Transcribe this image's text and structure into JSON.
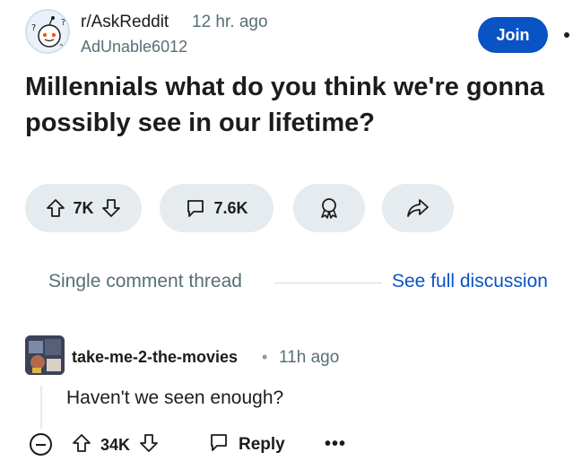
{
  "post": {
    "subreddit": "r/AskReddit",
    "time": "12 hr. ago",
    "author": "AdUnable6012",
    "join_label": "Join",
    "title": "Millennials what do you think we're gonna possibly see in our lifetime?",
    "votes": "7K",
    "comments": "7.6K"
  },
  "thread": {
    "label": "Single comment thread",
    "full_link": "See full discussion"
  },
  "comment": {
    "author": "take-me-2-the-movies",
    "separator": "•",
    "time": "11h ago",
    "body": "Haven't we seen enough?",
    "votes": "34K",
    "reply_label": "Reply",
    "more_label": "•••"
  },
  "colors": {
    "accent": "#0a53c4",
    "pill_bg": "#e5ebee",
    "meta_text": "#576f76"
  }
}
